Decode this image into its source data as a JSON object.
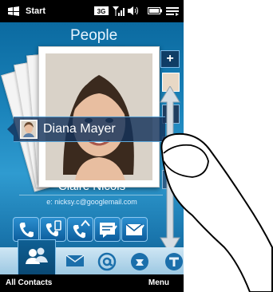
{
  "status_bar": {
    "start_label": "Start"
  },
  "header": {
    "title": "People"
  },
  "contact_slider": {
    "selected_name": "Diana Mayer"
  },
  "current_contact": {
    "name": "Claire Nicols",
    "email": "e: nicksy.c@googlemail.com"
  },
  "actions": [
    "phone-icon",
    "call-mobile-icon",
    "call-work-icon",
    "sms-icon",
    "email-icon"
  ],
  "bottom_nav": [
    "all-contacts-icon",
    "mail-icon",
    "at-icon",
    "contact-card-icon",
    "messages-icon"
  ],
  "softkeys": {
    "left": "All Contacts",
    "right": "Menu"
  },
  "add_button_label": "+"
}
